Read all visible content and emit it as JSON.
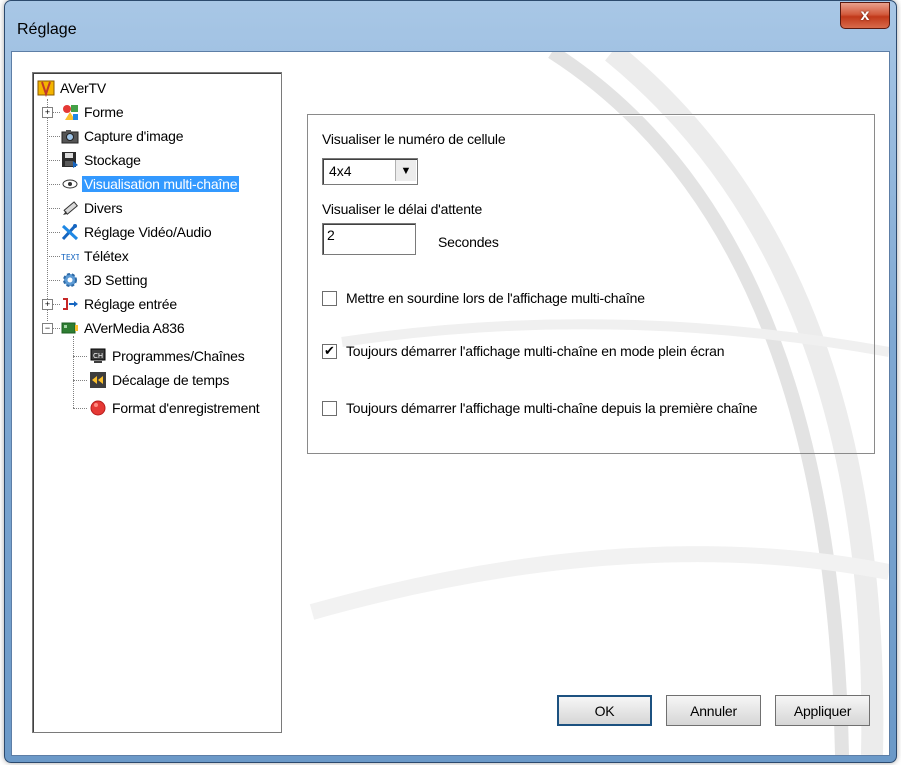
{
  "window": {
    "title": "Réglage",
    "close_label": "x"
  },
  "tree": {
    "root": "AVerTV",
    "items": [
      {
        "label": "Forme",
        "icon": "shapes-icon"
      },
      {
        "label": "Capture d'image",
        "icon": "camera-icon"
      },
      {
        "label": "Stockage",
        "icon": "floppy-disk-icon"
      },
      {
        "label": "Visualisation multi-chaîne",
        "icon": "eye-icon"
      },
      {
        "label": "Divers",
        "icon": "pen-icon"
      },
      {
        "label": "Réglage Vidéo/Audio",
        "icon": "tools-icon"
      },
      {
        "label": "Télétex",
        "icon": "text-icon"
      },
      {
        "label": "3D Setting",
        "icon": "gear-icon"
      },
      {
        "label": "Réglage entrée",
        "icon": "input-icon"
      },
      {
        "label": "AVerMedia A836",
        "icon": "device-icon"
      }
    ],
    "children": [
      {
        "label": "Programmes/Chaînes",
        "icon": "channel-list-icon"
      },
      {
        "label": "Décalage de temps",
        "icon": "timeshift-icon"
      },
      {
        "label": "Format d'enregistrement",
        "icon": "record-icon"
      }
    ],
    "expanders": [
      "+",
      "+",
      "−"
    ],
    "selected_color": "#3399ff"
  },
  "panel": {
    "cell_label": "Visualiser le numéro de cellule",
    "cell_value": "4x4",
    "delay_label": "Visualiser le délai d'attente",
    "delay_value": "2",
    "delay_unit": "Secondes",
    "options": [
      {
        "label": "Mettre en sourdine lors de l'affichage multi-chaîne",
        "checked": false
      },
      {
        "label": "Toujours démarrer l'affichage multi-chaîne en mode plein écran",
        "checked": true
      },
      {
        "label": "Toujours démarrer l'affichage multi-chaîne depuis la première chaîne",
        "checked": false
      }
    ],
    "check_mark": "✔"
  },
  "buttons": {
    "ok": "OK",
    "cancel": "Annuler",
    "apply": "Appliquer"
  }
}
